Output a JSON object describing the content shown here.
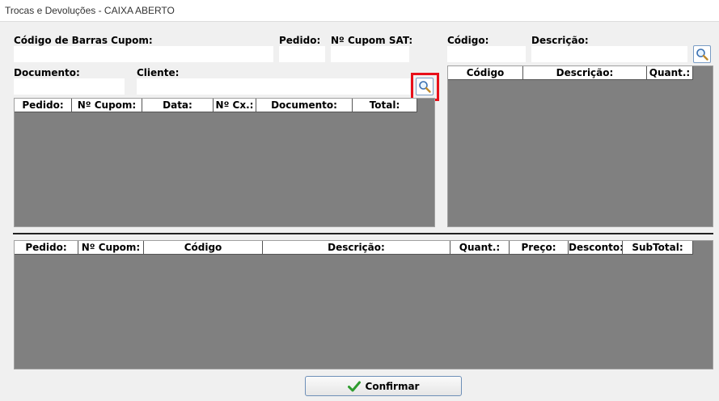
{
  "window": {
    "title": "Trocas e Devoluções - CAIXA ABERTO"
  },
  "cupom_form": {
    "codigo_barras_label": "Código de Barras Cupom:",
    "pedido_label": "Pedido:",
    "cupom_sat_label": "Nº Cupom SAT:",
    "documento_label": "Documento:",
    "cliente_label": "Cliente:"
  },
  "cupons_grid": {
    "columns": [
      "Pedido:",
      "Nº Cupom:",
      "Data:",
      "Nº Cx.:",
      "Documento:",
      "Total:"
    ]
  },
  "produto_form": {
    "codigo_label": "Código:",
    "descricao_label": "Descrição:"
  },
  "produtos_grid": {
    "columns": [
      "Código",
      "Descrição:",
      "Quant.:"
    ]
  },
  "itens_grid": {
    "columns": [
      "Pedido:",
      "Nº Cupom:",
      "Código",
      "Descrição:",
      "Quant.:",
      "Preço:",
      "Desconto:",
      "SubTotal:"
    ]
  },
  "footer": {
    "confirm_label": "Confirmar"
  },
  "colors": {
    "grid_background": "#808080",
    "highlight": "#e8101a",
    "confirm_icon": "#2e9c2e"
  },
  "icons": {
    "search_button": "magnifier-icon",
    "confirm_button": "checkmark-icon"
  }
}
